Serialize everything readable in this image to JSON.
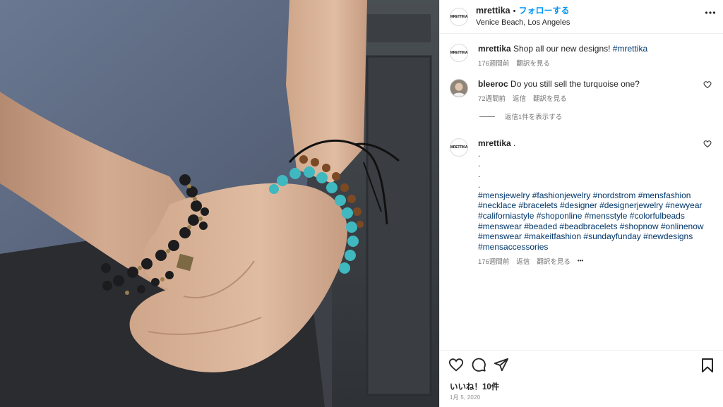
{
  "post": {
    "username": "mrettika",
    "avatar_text": "MRETTIKA",
    "separator": "•",
    "follow_label": "フォローする",
    "location": "Venice Beach, Los Angeles",
    "more_icon": "more-dots-icon"
  },
  "caption": {
    "username": "mrettika",
    "text": "Shop all our new designs! ",
    "hashtag": "#mrettika",
    "time": "176週間前",
    "translate": "翻訳を見る"
  },
  "comment1": {
    "username": "bleeroc",
    "text": "Do you still sell the turquoise one?",
    "time": "72週間前",
    "reply": "返信",
    "translate": "翻訳を見る",
    "view_replies": "返信1件を表示する"
  },
  "comment2": {
    "username": "mrettika",
    "text_first": ".",
    "dots": [
      ".",
      ".",
      ".",
      "."
    ],
    "hashtag_lines": [
      "#mensjewelry #fashionjewelry #nordstrom #mensfashion",
      "#necklace #bracelets #designer #designerjewelry #newyear",
      "#californiastyle #shoponline #mensstyle #colorfulbeads",
      "#menswear #beaded #beadbracelets #shopnow #onlinenow",
      "#menswear #makeitfashion #sundayfunday #newdesigns",
      "#mensaccessories"
    ],
    "time": "176週間前",
    "reply": "返信",
    "translate": "翻訳を見る",
    "more": "•••"
  },
  "footer": {
    "likes": "いいね！10件",
    "date": "1月 5, 2020"
  },
  "icons": {
    "like": "heart-icon",
    "comment": "comment-bubble-icon",
    "share": "paper-plane-icon",
    "save": "bookmark-icon"
  },
  "colors": {
    "link_blue": "#0095f6",
    "hashtag_blue": "#00376b",
    "muted": "#737373"
  }
}
